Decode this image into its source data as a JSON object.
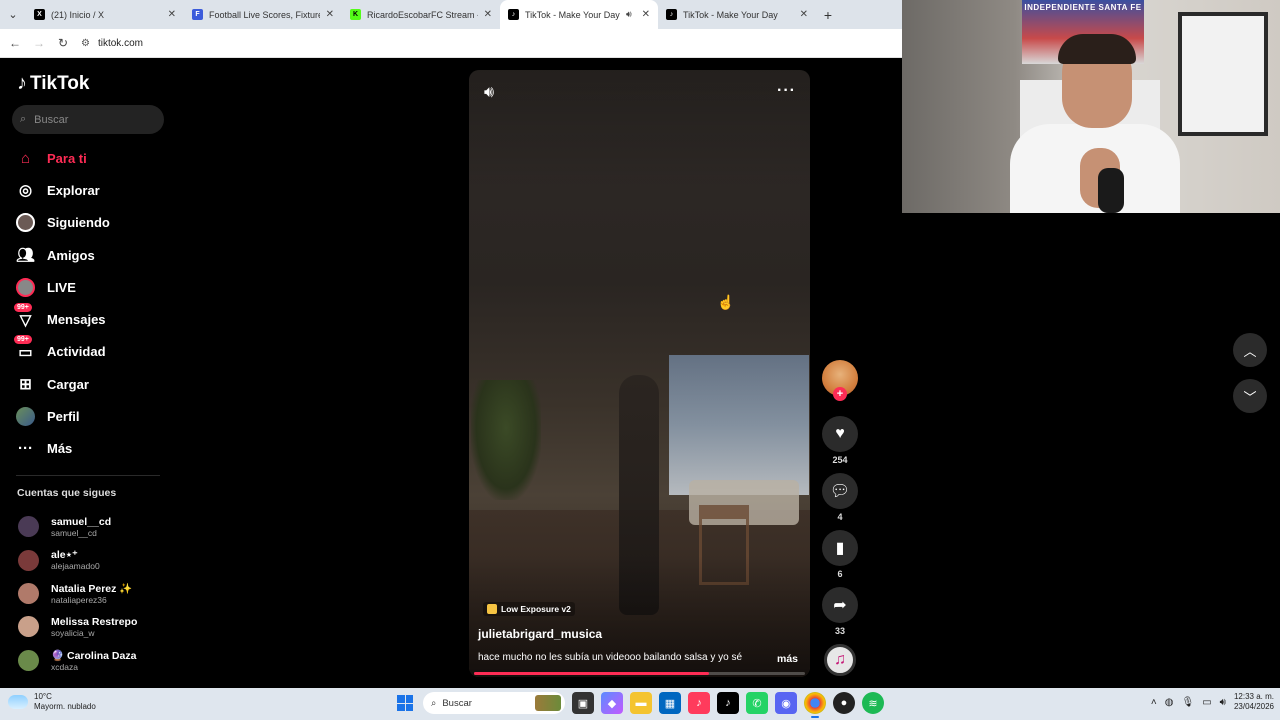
{
  "browser": {
    "tabs": [
      {
        "title": "(21) Inicio / X",
        "favicon": "x-logo",
        "color": "#000000",
        "active": false
      },
      {
        "title": "Football Live Scores, Fixtures &",
        "favicon": "football-logo",
        "color": "#3b5bdb",
        "active": false
      },
      {
        "title": "RicardoEscobarFC Stream - Wa",
        "favicon": "kick-logo",
        "color": "#53fc18",
        "active": false
      },
      {
        "title": "TikTok - Make Your Day",
        "favicon": "tiktok-logo",
        "color": "#000000",
        "active": true
      },
      {
        "title": "TikTok - Make Your Day",
        "favicon": "tiktok-logo",
        "color": "#000000",
        "active": false
      }
    ],
    "url": "tiktok.com"
  },
  "tiktok": {
    "brand": "TikTok",
    "search_placeholder": "Buscar",
    "nav": [
      {
        "label": "Para ti",
        "icon": "home-icon",
        "active": true
      },
      {
        "label": "Explorar",
        "icon": "compass-icon"
      },
      {
        "label": "Siguiendo",
        "icon": "following-avatar-icon"
      },
      {
        "label": "Amigos",
        "icon": "friends-icon"
      },
      {
        "label": "LIVE",
        "icon": "live-icon"
      },
      {
        "label": "Mensajes",
        "icon": "messages-icon",
        "badge": "99+"
      },
      {
        "label": "Actividad",
        "icon": "activity-icon",
        "badge": "99+"
      },
      {
        "label": "Cargar",
        "icon": "upload-icon"
      },
      {
        "label": "Perfil",
        "icon": "profile-avatar-icon"
      },
      {
        "label": "Más",
        "icon": "more-icon"
      }
    ],
    "following_title": "Cuentas que sigues",
    "following": [
      {
        "name": "samuel__cd",
        "handle": "samuel__cd",
        "color": "#4a3a55"
      },
      {
        "name": "ale⋆⁺",
        "handle": "alejaamado0",
        "color": "#7a3a3a"
      },
      {
        "name": "Natalia Perez ✨",
        "handle": "nataliaperez36",
        "color": "#b07a6a"
      },
      {
        "name": "Melissa Restrepo",
        "handle": "soyalicia_w",
        "color": "#c9a08a"
      },
      {
        "name": "🔮 Carolina Daza",
        "handle": "xcdaza",
        "color": "#6a8a4a"
      }
    ],
    "video": {
      "effect": "Low Exposure v2",
      "author": "julietabrigard_musica",
      "caption": "hace mucho no les subía un videooo bailando salsa y yo sé",
      "more": "más",
      "progress": 0.71
    },
    "actions": {
      "likes": "254",
      "comments": "4",
      "saves": "6",
      "shares": "33"
    }
  },
  "webcam": {
    "poster_text": "INDEPENDIENTE SANTA FE"
  },
  "taskbar": {
    "weather_temp": "10°C",
    "weather_desc": "Mayorm. nublado",
    "search": "Buscar",
    "time": "12:33 a. m.",
    "date": "23/04/2026"
  }
}
